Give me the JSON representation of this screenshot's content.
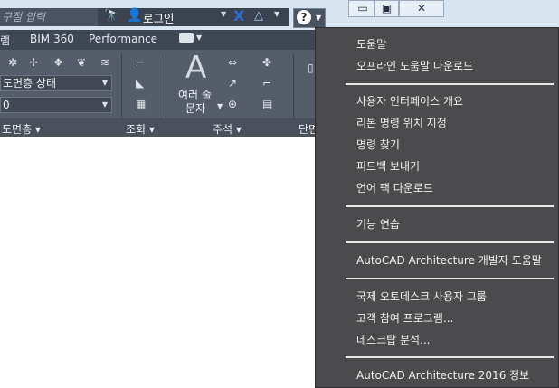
{
  "titlebar": {
    "search_placeholder": "구절 입력",
    "login_label": "로그인",
    "help_symbol": "?",
    "window_buttons": [
      "▭",
      "▣",
      "✕"
    ]
  },
  "ribbon_tabs": [
    "램",
    "BIM 360",
    "Performance"
  ],
  "ribbon": {
    "layer_state": "도면층 상태",
    "layer_value": "0",
    "multiline_text": [
      "여러 줄",
      "문자"
    ],
    "panels": [
      "도면층 ▾",
      "조회 ▾",
      "주석 ▾",
      "단면"
    ]
  },
  "help_menu": {
    "groups": [
      [
        "도움말",
        "오프라인 도움말 다운로드"
      ],
      [
        "사용자 인터페이스 개요",
        "리본 명령 위치 지정",
        "명령 찾기",
        "피드백 보내기",
        "언어 팩 다운로드"
      ],
      [
        "기능 연습"
      ],
      [
        "AutoCAD Architecture 개발자 도움말"
      ],
      [
        "국제 오토데스크 사용자 그룹",
        "고객 참여 프로그램...",
        "데스크탑 분석..."
      ],
      [
        "AutoCAD Architecture 2016 정보"
      ]
    ]
  },
  "colors": {
    "menu_bg": "#4b4b4d",
    "ribbon_bg": "#555d6a",
    "titlebar_bg": "#d9e4f1"
  }
}
